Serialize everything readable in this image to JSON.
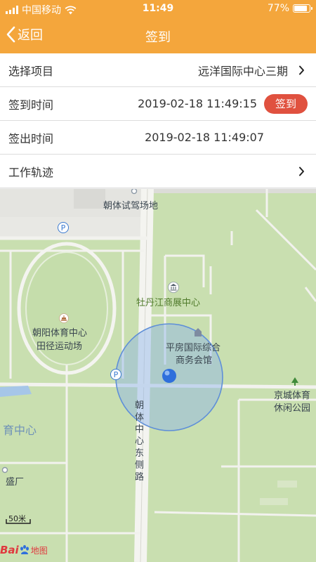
{
  "status": {
    "carrier": "中国移动",
    "time": "11:49",
    "battery": "77%",
    "battery_level": 0.77
  },
  "nav": {
    "back_label": "返回",
    "title": "签到"
  },
  "rows": {
    "project": {
      "label": "选择项目",
      "value": "远洋国际中心三期"
    },
    "signin": {
      "label": "签到时间",
      "value": "2019-02-18 11:49:15",
      "button": "签到"
    },
    "signout": {
      "label": "签出时间",
      "value": "2019-02-18 11:49:07"
    },
    "track": {
      "label": "工作轨迹"
    }
  },
  "map": {
    "labels": {
      "driving_school": "朝体试驾场地",
      "expo_center": "牡丹江商展中心",
      "stadium_line1": "朝阳体育中心",
      "stadium_line2": "田径运动场",
      "hall_line1": "平房国际综合",
      "hall_line2": "商务会馆",
      "road": "朝体中心东侧路",
      "park_line1": "京城体育",
      "park_line2": "休闲公园",
      "sports_center": "育中心",
      "factory": "盛厂"
    },
    "scale": "50米",
    "logo_text": "地图",
    "parking": "P"
  },
  "colors": {
    "accent": "#f4a63c",
    "signin_button": "#e0513f"
  }
}
